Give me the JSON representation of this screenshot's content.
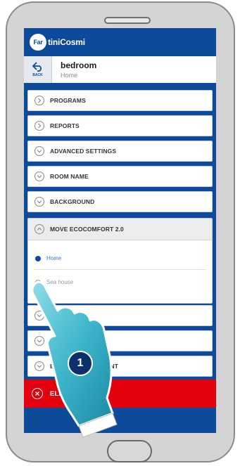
{
  "app": {
    "logo_mark": "Far",
    "logo_text": "tiniCosmi",
    "back_label": "BACK",
    "room_title": "bedroom",
    "room_subtitle": "Home"
  },
  "menu": {
    "items": [
      {
        "label": "PROGRAMS",
        "icon": "chevron-right-icon"
      },
      {
        "label": "REPORTS",
        "icon": "chevron-right-icon"
      },
      {
        "label": "ADVANCED SETTINGS",
        "icon": "chevron-down-icon"
      },
      {
        "label": "ROOM NAME",
        "icon": "chevron-down-icon"
      },
      {
        "label": "BACKGROUND",
        "icon": "chevron-down-icon"
      }
    ],
    "expanded": {
      "label": "MOVE ECOCOMFORT 2.0",
      "icon": "chevron-up-icon",
      "options": [
        {
          "label": "Home",
          "selected": true
        },
        {
          "label": "Sea house",
          "selected": false
        }
      ]
    },
    "lower_items": [
      {
        "label": "ARE",
        "icon": "chevron-down-icon"
      },
      {
        "label": "",
        "icon": "chevron-down-icon"
      },
      {
        "label": "E        D MANAGEMENT",
        "icon": "chevron-down-icon"
      }
    ],
    "delete_label": "ELIM             YMC"
  },
  "overlay": {
    "step_number": "1"
  },
  "colors": {
    "brand_blue": "#0d4a9a",
    "delete_red": "#e3000f",
    "hand_cyan": "#3fb6cc"
  }
}
